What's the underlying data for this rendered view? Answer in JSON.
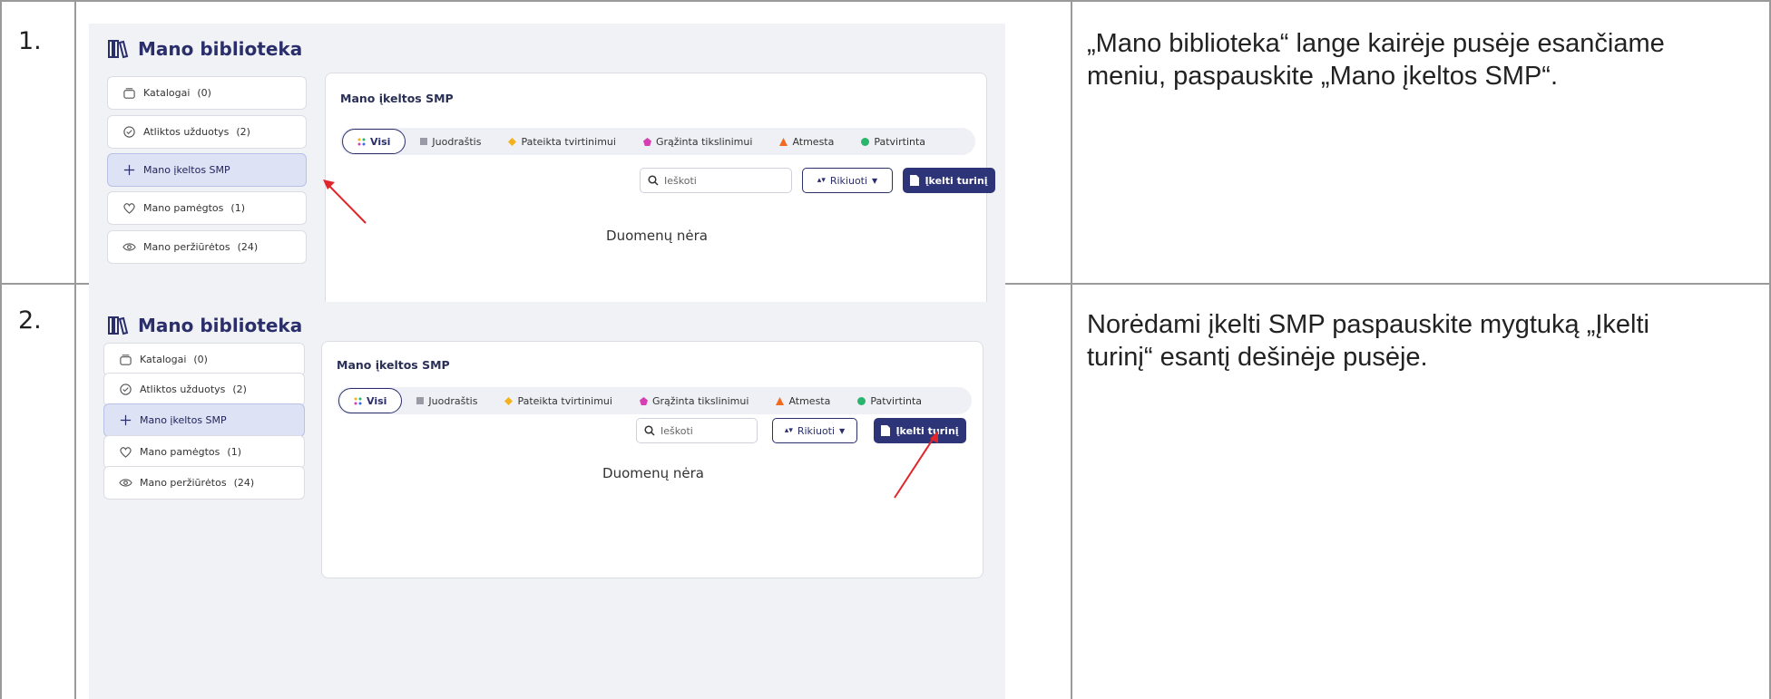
{
  "steps": [
    {
      "number": "1.",
      "instruction": "„Mano biblioteka“ lange kairėje pusėje esančiame meniu, paspauskite „Mano įkeltos SMP“."
    },
    {
      "number": "2.",
      "instruction": "Norėdami įkelti SMP paspauskite mygtuką „Įkelti turinį“ esantį dešinėje pusėje."
    }
  ],
  "screen": {
    "library_title": "Mano biblioteka",
    "menu": [
      {
        "label": "Katalogai",
        "count": "(0)",
        "icon": "catalog-icon"
      },
      {
        "label": "Atliktos užduotys",
        "count": "(2)",
        "icon": "check-circle-icon"
      },
      {
        "label": "Mano įkeltos SMP",
        "count": "",
        "icon": "plus-icon"
      },
      {
        "label": "Mano pamėgtos",
        "count": "(1)",
        "icon": "heart-icon"
      },
      {
        "label": "Mano peržiūrėtos",
        "count": "(24)",
        "icon": "eye-icon"
      }
    ],
    "active_menu_index": 2,
    "card_title": "Mano įkeltos SMP",
    "filters": [
      {
        "label": "Visi",
        "color": "#2a2f6b"
      },
      {
        "label": "Juodraštis",
        "color": "#9a9aa6"
      },
      {
        "label": "Pateikta tvirtinimui",
        "color": "#f3b21a"
      },
      {
        "label": "Grąžinta tikslinimui",
        "color": "#d63fb1"
      },
      {
        "label": "Atmesta",
        "color": "#f06a1f"
      },
      {
        "label": "Patvirtinta",
        "color": "#2bb56c"
      }
    ],
    "search_placeholder": "Ieškoti",
    "sort_label": "Rikiuoti",
    "upload_label": "Įkelti turinį",
    "empty_text": "Duomenų nėra"
  },
  "colors": {
    "accent": "#2d3478",
    "annotation_arrow": "#e0262a",
    "panel_bg": "#f1f2f6",
    "active_menu_bg": "#dde2f5"
  }
}
